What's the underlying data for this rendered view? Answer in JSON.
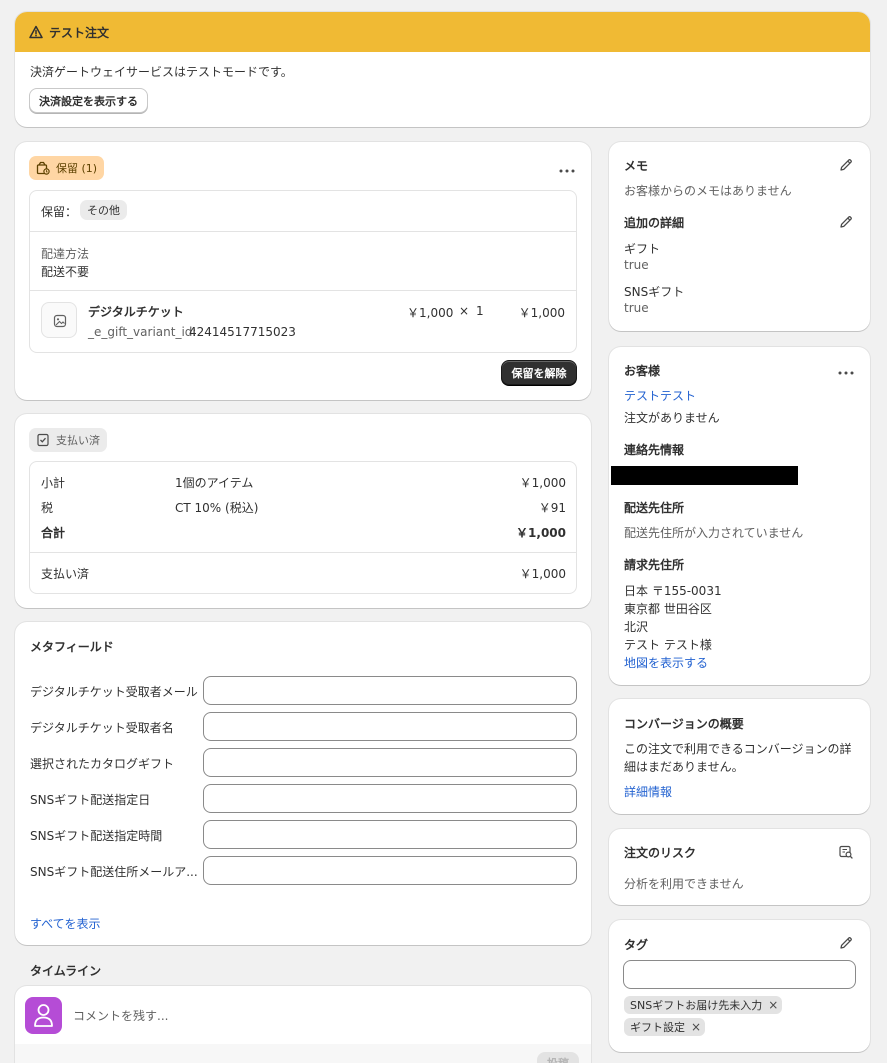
{
  "test_banner": {
    "title": "テスト注文",
    "message": "決済ゲートウェイサービスはテストモードです。",
    "button_label": "決済設定を表示する",
    "color": "#f0ba34"
  },
  "hold_card": {
    "badge": "保留 (1)",
    "hold_label": "保留：",
    "hold_reason": "その他",
    "delivery_method_label": "配達方法",
    "delivery_method_value": "配送不要",
    "item": {
      "name": "デジタルチケット",
      "property_key": "_e_gift_variant_id:",
      "property_value": "42414517715023",
      "price": "￥1,000",
      "times": "×",
      "quantity": "1",
      "total": "￥1,000"
    },
    "release_button": "保留を解除"
  },
  "payment_card": {
    "badge": "支払い済",
    "rows": [
      {
        "label": "小計",
        "detail": "1個のアイテム",
        "amount": "￥1,000"
      },
      {
        "label": "税",
        "detail": "CT 10% (税込)",
        "amount": "￥91"
      },
      {
        "label": "合計",
        "detail": "",
        "amount": "￥1,000"
      }
    ],
    "paid_label": "支払い済",
    "paid_amount": "￥1,000"
  },
  "metafields": {
    "title": "メタフィールド",
    "fields": [
      {
        "label": "デジタルチケット受取者メール",
        "value": ""
      },
      {
        "label": "デジタルチケット受取者名",
        "value": ""
      },
      {
        "label": "選択されたカタログギフト",
        "value": ""
      },
      {
        "label": "SNSギフト配送指定日",
        "value": ""
      },
      {
        "label": "SNSギフト配送指定時間",
        "value": ""
      },
      {
        "label": "SNSギフト配送住所メールア...",
        "value": ""
      }
    ],
    "show_all": "すべてを表示"
  },
  "timeline": {
    "title": "タイムライン",
    "comment_placeholder": "コメントを残す...",
    "post_button": "投稿"
  },
  "notes": {
    "title": "メモ",
    "empty": "お客様からのメモはありません",
    "additional_title": "追加の詳細",
    "details": [
      {
        "key": "ギフト",
        "value": "true"
      },
      {
        "key": "SNSギフト",
        "value": "true"
      }
    ]
  },
  "customer": {
    "title": "お客様",
    "name": "テストテスト",
    "orders": "注文がありません",
    "contact_title": "連絡先情報",
    "shipping_title": "配送先住所",
    "shipping_empty": "配送先住所が入力されていません",
    "billing_title": "請求先住所",
    "billing_lines": [
      "日本 〒155-0031",
      "東京都 世田谷区",
      "北沢",
      "テスト テスト様"
    ],
    "map_link": "地図を表示する"
  },
  "conversion": {
    "title": "コンバージョンの概要",
    "text_line1": "この注文で利用できるコンバージョンの詳",
    "text_line2": "細はまだありません。",
    "link": "詳細情報"
  },
  "risk": {
    "title": "注文のリスク",
    "text": "分析を利用できません"
  },
  "tags": {
    "title": "タグ",
    "input_value": "",
    "items": [
      "SNSギフトお届け先未入力",
      "ギフト設定"
    ]
  },
  "colors": {
    "background": "#f1f1f1",
    "link": "#2463d1",
    "hold_badge": "#ffd6a4",
    "avatar": "#b54cd6"
  }
}
